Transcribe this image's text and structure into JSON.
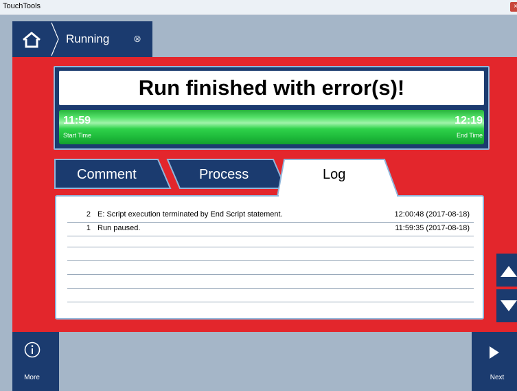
{
  "window": {
    "title": "TouchTools",
    "close_glyph": "×"
  },
  "nav": {
    "home_icon": "home-icon",
    "tab_label": "Running",
    "tab_close_glyph": "⊗"
  },
  "status": {
    "title": "Run finished with error(s)!",
    "start_time": "11:59",
    "start_label": "Start Time",
    "end_time": "12:19",
    "end_label": "End Time",
    "progress_fraction": 1.0
  },
  "tabs": [
    {
      "label": "Comment",
      "active": false
    },
    {
      "label": "Process",
      "active": false
    },
    {
      "label": "Log",
      "active": true
    }
  ],
  "log": {
    "rows": [
      {
        "num": "2",
        "message": "E: Script execution terminated by End Script statement.",
        "timestamp": "12:00:48 (2017-08-18)"
      },
      {
        "num": "1",
        "message": "Run paused.",
        "timestamp": "11:59:35 (2017-08-18)"
      }
    ]
  },
  "footer": {
    "more_label": "More",
    "next_label": "Next"
  },
  "colors": {
    "navy": "#1b3b6f",
    "red": "#e3262c",
    "panel_border": "#8fb6db",
    "slate": "#a5b6c8",
    "green": "#2fd24a"
  }
}
